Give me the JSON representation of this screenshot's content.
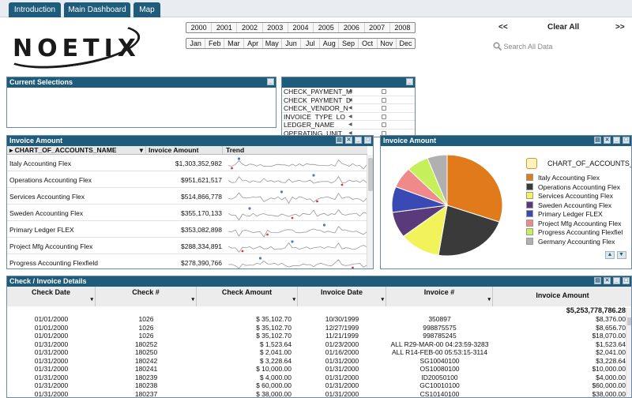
{
  "tabs": [
    {
      "label": "Introduction"
    },
    {
      "label": "Main Dashboard"
    },
    {
      "label": "Map"
    }
  ],
  "logo": {
    "text": "NOETIX"
  },
  "years": [
    "2000",
    "2001",
    "2002",
    "2003",
    "2004",
    "2005",
    "2006",
    "2007",
    "2008"
  ],
  "months": [
    "Jan",
    "Feb",
    "Mar",
    "Apr",
    "May",
    "Jun",
    "Jul",
    "Aug",
    "Sep",
    "Oct",
    "Nov",
    "Dec"
  ],
  "nav": {
    "prev": "<<",
    "clear_all": "Clear All",
    "next": ">>"
  },
  "search": {
    "placeholder": "Search All Data",
    "icon": "search-icon"
  },
  "current_selections": {
    "title": "Current Selections"
  },
  "listbox": {
    "items": [
      "CHECK_PAYMENT_M",
      "CHECK_PAYMENT_D",
      "CHECK_VENDOR_N",
      "INVOICE_TYPE_LO",
      "LEDGER_NAME",
      "OPERATING_UNIT"
    ]
  },
  "invoice_table": {
    "title": "Invoice Amount",
    "columns": [
      "CHART_OF_ACCOUNTS_NAME",
      "Invoice Amount",
      "Trend"
    ],
    "rows": [
      {
        "name": "Italy Accounting Flex",
        "amount": "$1,303,352,982"
      },
      {
        "name": "Operations Accounting Flex",
        "amount": "$951,621,517"
      },
      {
        "name": "Services Accounting Flex",
        "amount": "$514,866,778"
      },
      {
        "name": "Sweden Accounting Flex",
        "amount": "$355,170,133"
      },
      {
        "name": "Primary Ledger FLEX",
        "amount": "$353,082,898"
      },
      {
        "name": "Project Mfg Accounting Flex",
        "amount": "$288,334,891"
      },
      {
        "name": "Progress Accounting Flexfield",
        "amount": "$278,390,766"
      }
    ]
  },
  "pie": {
    "title": "Invoice Amount",
    "legend_title": "CHART_OF_ACCOUNTS_NA",
    "colors": {
      "accent": "#1f5b7a"
    }
  },
  "chart_data": {
    "type": "pie",
    "title": "Invoice Amount",
    "categories": [
      "Italy Accounting Flex",
      "Operations Accounting Flex",
      "Services Accounting Flex",
      "Sweden Accounting Flex",
      "Primary Ledger FLEX",
      "Project Mfg Accounting Flex",
      "Progress Accounting Flexfiel",
      "Germany Accounting Flex"
    ],
    "values": [
      1303352982,
      951621517,
      514866778,
      355170133,
      353082898,
      288334891,
      278390766,
      250000000
    ],
    "colors": [
      "#e07a1a",
      "#3a3a3a",
      "#f2f25a",
      "#5a3a7a",
      "#3a4ab5",
      "#f08a8a",
      "#c5f05a",
      "#b0b0b0"
    ],
    "legend_position": "right"
  },
  "details": {
    "title": "Check / Invoice Details",
    "columns": [
      "Check Date",
      "Check #",
      "Check Amount",
      "Invoice Date",
      "Invoice #",
      "Invoice Amount"
    ],
    "total": "$5,253,778,786.28",
    "rows": [
      [
        "01/01/2000",
        "1026",
        "$ 35,102.70",
        "10/30/1999",
        "350897",
        "$8,376.00"
      ],
      [
        "01/01/2000",
        "1026",
        "$ 35,102.70",
        "12/27/1999",
        "998875575",
        "$8,656.70"
      ],
      [
        "01/01/2000",
        "1026",
        "$ 35,102.70",
        "11/21/1999",
        "998785245",
        "$18,070.00"
      ],
      [
        "01/31/2000",
        "180252",
        "$ 1,523.64",
        "01/23/2000",
        "ALL R29-MAR-00 04:23:59-3283",
        "$1,523.64"
      ],
      [
        "01/31/2000",
        "180250",
        "$ 2,041.00",
        "01/16/2000",
        "ALL R14-FEB-00 05:53:15-3114",
        "$2,041.00"
      ],
      [
        "01/31/2000",
        "180242",
        "$ 3,228.64",
        "01/31/2000",
        "SG10040100",
        "$3,228.64"
      ],
      [
        "01/31/2000",
        "180241",
        "$ 10,000.00",
        "01/31/2000",
        "OS10080100",
        "$10,000.00"
      ],
      [
        "01/31/2000",
        "180239",
        "$ 4,000.00",
        "01/31/2000",
        "ID20050100",
        "$4,000.00"
      ],
      [
        "01/31/2000",
        "180238",
        "$ 60,000.00",
        "01/31/2000",
        "GC10010100",
        "$60,000.00"
      ],
      [
        "01/31/2000",
        "180237",
        "$ 38,000.00",
        "01/31/2000",
        "CS10140100",
        "$38,000.00"
      ]
    ]
  }
}
